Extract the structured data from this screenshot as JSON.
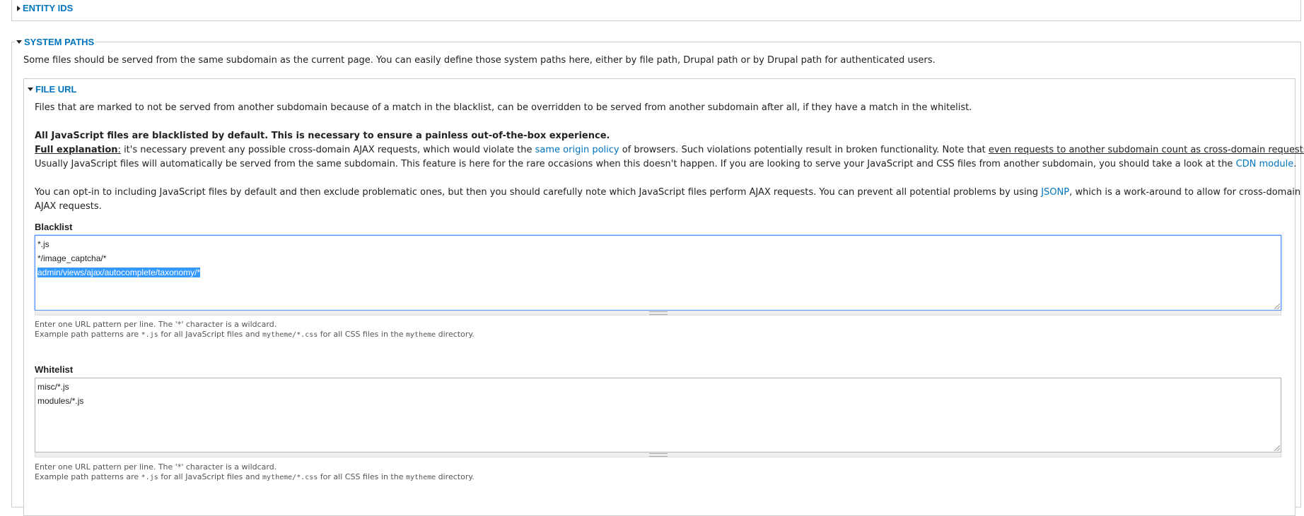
{
  "entity_ids": {
    "legend": "ENTITY IDS"
  },
  "system_paths": {
    "legend": "SYSTEM PATHS",
    "description": "Some files should be served from the same subdomain as the current page. You can easily define those system paths here, either by file path, Drupal path or by Drupal path for authenticated users."
  },
  "file_url": {
    "legend": "FILE URL",
    "intro": "Files that are marked to not be served from another subdomain because of a match in the blacklist, can be overridden to be served from another subdomain after all, if they have a match in the whitelist.",
    "js_heading": "All JavaScript files are blacklisted by default. This is necessary to ensure a painless out-of-the-box experience.",
    "full_explanation_label": "Full explanation",
    "full_explanation_colon": ":",
    "expl_part1": " it's necessary prevent any possible cross-domain AJAX requests, which would violate the ",
    "same_origin_link": "same origin policy",
    "expl_part2": " of browsers. Such violations potentially result in broken functionality. Note that ",
    "expl_underlined": "even requests to another subdomain count as cross-domain requests!",
    "expl_line2_part1": "Usually JavaScript files will automatically be served from the same subdomain. This feature is here for the rare occasions when this doesn't happen. If you are looking to serve your JavaScript and CSS files from another subdomain, you should take a look at the ",
    "cdn_link": "CDN module",
    "expl_line2_end": ".",
    "optin_part1": "You can opt-in to including JavaScript files by default and then exclude problematic ones, but then you should carefully note which JavaScript files perform AJAX requests. You can prevent all potential problems by using ",
    "jsonp_link": "JSONP",
    "optin_part2": ", which is a work-around to allow for cross-domain",
    "optin_line2": "AJAX requests."
  },
  "blacklist": {
    "label": "Blacklist",
    "lines": [
      "*.js",
      "*/image_captcha/*"
    ],
    "selected_line": "admin/views/ajax/autocomplete/taxonomy/*",
    "help_line1": "Enter one URL pattern per line. The '*' character is a wildcard.",
    "help_prefix": "Example path patterns are ",
    "help_code1": "*.js",
    "help_mid": " for all JavaScript files and ",
    "help_code2": "mytheme/*.css",
    "help_mid2": " for all CSS files in the ",
    "help_code3": "mytheme",
    "help_suffix": " directory."
  },
  "whitelist": {
    "label": "Whitelist",
    "lines": [
      "misc/*.js",
      "modules/*.js"
    ],
    "help_line1": "Enter one URL pattern per line. The '*' character is a wildcard.",
    "help_prefix": "Example path patterns are ",
    "help_code1": "*.js",
    "help_mid": " for all JavaScript files and ",
    "help_code2": "mytheme/*.css",
    "help_mid2": " for all CSS files in the ",
    "help_code3": "mytheme",
    "help_suffix": " directory."
  }
}
